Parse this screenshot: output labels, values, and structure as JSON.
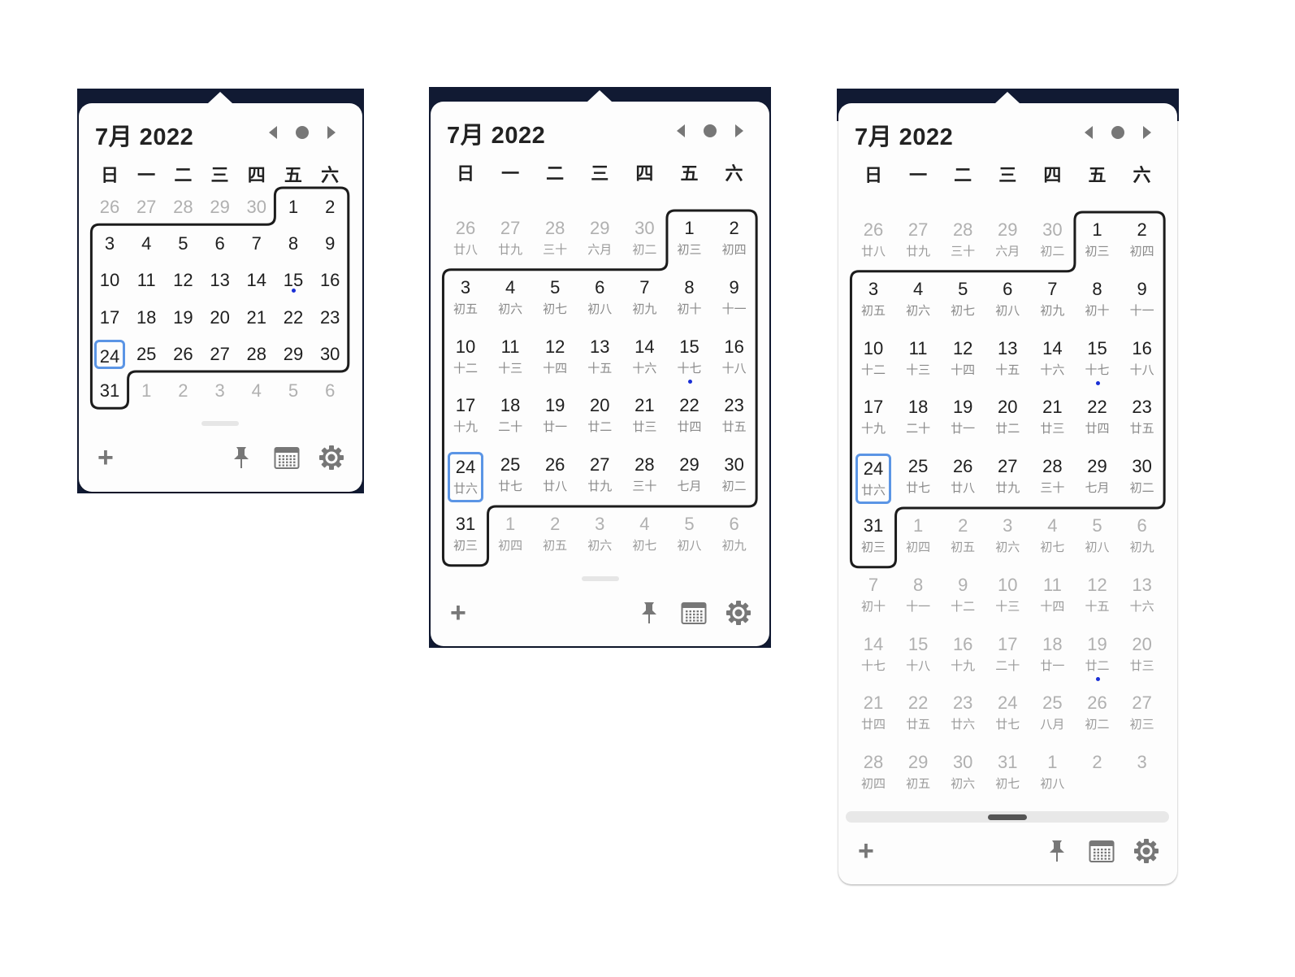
{
  "colors": {
    "accent": "#5b95e5",
    "event_dot": "#1a2fd6",
    "backdrop": "#111a33"
  },
  "title": "7月 2022",
  "weekdays": [
    "日",
    "一",
    "二",
    "三",
    "四",
    "五",
    "六"
  ],
  "icons": [
    "chevron-left-icon",
    "today-dot-icon",
    "chevron-right-icon",
    "add-icon",
    "pin-icon",
    "calendar-icon",
    "gear-icon"
  ],
  "footer": {
    "add_label": "+"
  },
  "compact": {
    "days": [
      "26",
      "27",
      "28",
      "29",
      "30",
      "1",
      "2",
      "3",
      "4",
      "5",
      "6",
      "7",
      "8",
      "9",
      "10",
      "11",
      "12",
      "13",
      "14",
      "15",
      "16",
      "17",
      "18",
      "19",
      "20",
      "21",
      "22",
      "23",
      "24",
      "25",
      "26",
      "27",
      "28",
      "29",
      "30",
      "31",
      "1",
      "2",
      "3",
      "4",
      "5",
      "6"
    ]
  },
  "lunar": {
    "days": [
      "26",
      "27",
      "28",
      "29",
      "30",
      "1",
      "2",
      "3",
      "4",
      "5",
      "6",
      "7",
      "8",
      "9",
      "10",
      "11",
      "12",
      "13",
      "14",
      "15",
      "16",
      "17",
      "18",
      "19",
      "20",
      "21",
      "22",
      "23",
      "24",
      "25",
      "26",
      "27",
      "28",
      "29",
      "30",
      "31",
      "1",
      "2",
      "3",
      "4",
      "5",
      "6"
    ],
    "lunar": [
      "廿八",
      "廿九",
      "三十",
      "六月",
      "初二",
      "初三",
      "初四",
      "初五",
      "初六",
      "初七",
      "初八",
      "初九",
      "初十",
      "十一",
      "十二",
      "十三",
      "十四",
      "十五",
      "十六",
      "十七",
      "十八",
      "十九",
      "二十",
      "廿一",
      "廿二",
      "廿三",
      "廿四",
      "廿五",
      "廿六",
      "廿七",
      "廿八",
      "廿九",
      "三十",
      "七月",
      "初二",
      "初三",
      "初四",
      "初五",
      "初六",
      "初七",
      "初八",
      "初九"
    ]
  },
  "extended": {
    "days": [
      "26",
      "27",
      "28",
      "29",
      "30",
      "1",
      "2",
      "3",
      "4",
      "5",
      "6",
      "7",
      "8",
      "9",
      "10",
      "11",
      "12",
      "13",
      "14",
      "15",
      "16",
      "17",
      "18",
      "19",
      "20",
      "21",
      "22",
      "23",
      "24",
      "25",
      "26",
      "27",
      "28",
      "29",
      "30",
      "31",
      "1",
      "2",
      "3",
      "4",
      "5",
      "6",
      "7",
      "8",
      "9",
      "10",
      "11",
      "12",
      "13",
      "14",
      "15",
      "16",
      "17",
      "18",
      "19",
      "20",
      "21",
      "22",
      "23",
      "24",
      "25",
      "26",
      "27",
      "28",
      "29",
      "30",
      "31",
      "1",
      "2",
      "3"
    ],
    "lunar": [
      "廿八",
      "廿九",
      "三十",
      "六月",
      "初二",
      "初三",
      "初四",
      "初五",
      "初六",
      "初七",
      "初八",
      "初九",
      "初十",
      "十一",
      "十二",
      "十三",
      "十四",
      "十五",
      "十六",
      "十七",
      "十八",
      "十九",
      "二十",
      "廿一",
      "廿二",
      "廿三",
      "廿四",
      "廿五",
      "廿六",
      "廿七",
      "廿八",
      "廿九",
      "三十",
      "七月",
      "初二",
      "初三",
      "初四",
      "初五",
      "初六",
      "初七",
      "初八",
      "初九",
      "初十",
      "十一",
      "十二",
      "十三",
      "十四",
      "十五",
      "十六",
      "十七",
      "十八",
      "十九",
      "二十",
      "廿一",
      "廿二",
      "廿三",
      "廿四",
      "廿五",
      "廿六",
      "廿七",
      "八月",
      "初二",
      "初三",
      "初四",
      "初五",
      "初六",
      "初七",
      "初八"
    ]
  },
  "month_start_index": 5,
  "month_end_index": 35,
  "today_index": 28,
  "event_indices": [
    19,
    54
  ]
}
